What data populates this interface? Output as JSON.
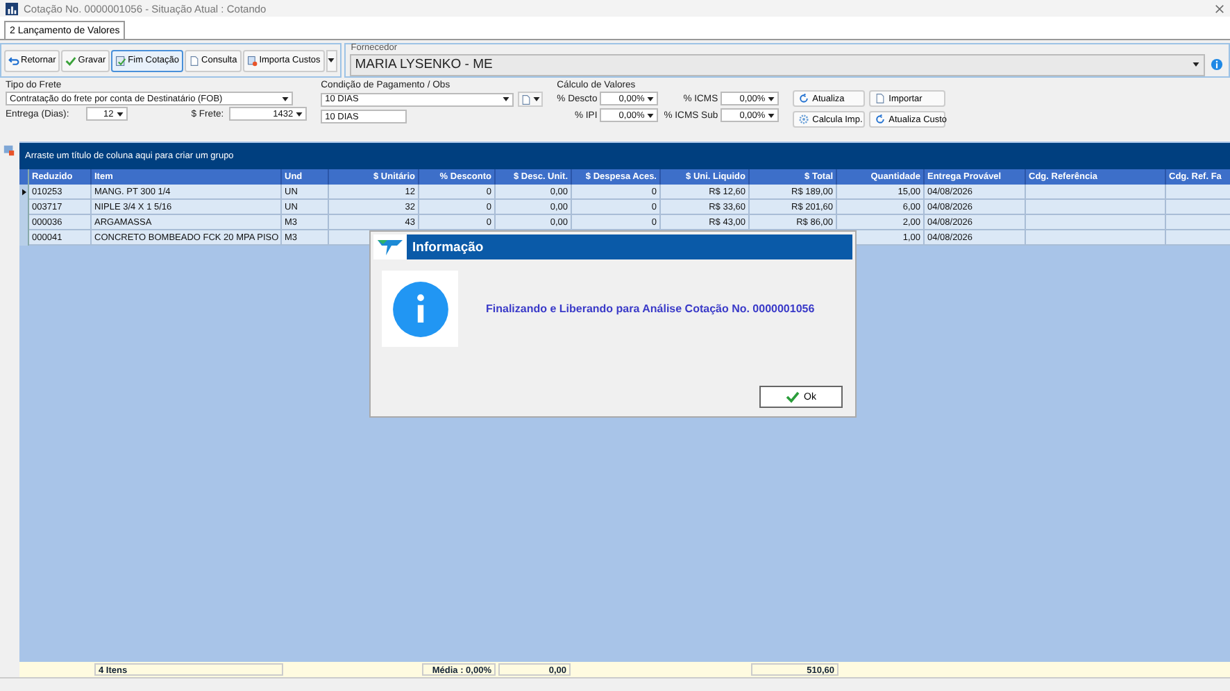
{
  "window": {
    "title": "Cotação No. 0000001056 - Situação Atual : Cotando"
  },
  "tabs": [
    {
      "label": "2 Lançamento de Valores",
      "selected": true
    }
  ],
  "toolbar": [
    {
      "label": "Retornar",
      "kind": "undo",
      "focused": false
    },
    {
      "label": "Gravar",
      "kind": "check",
      "focused": false
    },
    {
      "label": "Fim Cotação",
      "kind": "finish",
      "focused": true
    },
    {
      "label": "Consulta",
      "kind": "doc",
      "focused": false
    },
    {
      "label": "Importa Custos",
      "kind": "import",
      "focused": false
    }
  ],
  "fornecedor": {
    "label": "Fornecedor",
    "value": "MARIA LYSENKO - ME"
  },
  "frete": {
    "label": "Tipo do Frete",
    "value": "Contratação do frete por conta de Destinatário (FOB)",
    "entrega_label": "Entrega (Dias):",
    "entrega": "12",
    "frete_label": "$ Frete:",
    "frete": "1432"
  },
  "pagamento": {
    "label": "Condição de Pagamento / Obs",
    "value": "10 DIAS",
    "obs": "10 DIAS"
  },
  "calculo": {
    "label": "Cálculo de Valores",
    "fields": [
      {
        "label": "% Descto",
        "value": "0,00%"
      },
      {
        "label": "% ICMS",
        "value": "0,00%"
      },
      {
        "label": "% IPI",
        "value": "0,00%"
      },
      {
        "label": "% ICMS Sub",
        "value": "0,00%"
      }
    ],
    "buttons": [
      {
        "label": "Atualiza",
        "kind": "refresh"
      },
      {
        "label": "Importar",
        "kind": "doc"
      },
      {
        "label": "Calcula Imp.",
        "kind": "gear"
      },
      {
        "label": "Atualiza Custo",
        "kind": "refresh"
      }
    ]
  },
  "grid": {
    "group_hint": "Arraste um título de coluna aqui para criar um grupo",
    "columns": [
      {
        "label": "Reduzido",
        "numeric": false
      },
      {
        "label": "Item",
        "numeric": false
      },
      {
        "label": "Und",
        "numeric": false
      },
      {
        "label": "$ Unitário",
        "numeric": true
      },
      {
        "label": "% Desconto",
        "numeric": true
      },
      {
        "label": "$ Desc. Unit.",
        "numeric": true
      },
      {
        "label": "$ Despesa Aces.",
        "numeric": true
      },
      {
        "label": "$ Uni. Liquido",
        "numeric": true
      },
      {
        "label": "$ Total",
        "numeric": true
      },
      {
        "label": "Quantidade",
        "numeric": true
      },
      {
        "label": "Entrega Provável",
        "numeric": false
      },
      {
        "label": "Cdg. Referência",
        "numeric": false
      },
      {
        "label": "Cdg. Ref. Fa",
        "numeric": false
      }
    ],
    "rows": [
      {
        "current": true,
        "cells": [
          "010253",
          " MANG. PT 300 1/4",
          "UN",
          "12",
          "0",
          "0,00",
          "0",
          "R$ 12,60",
          "R$ 189,00",
          "15,00",
          "04/08/2026",
          null,
          null
        ]
      },
      {
        "current": false,
        "cells": [
          "003717",
          "NIPLE 3/4 X 1 5/16",
          "UN",
          "32",
          "0",
          "0,00",
          "0",
          "R$ 33,60",
          "R$ 201,60",
          "6,00",
          "04/08/2026",
          null,
          null
        ]
      },
      {
        "current": false,
        "cells": [
          "000036",
          "ARGAMASSA",
          "M3",
          "43",
          "0",
          "0,00",
          "0",
          "R$ 43,00",
          "R$ 86,00",
          "2,00",
          "04/08/2026",
          null,
          null
        ]
      },
      {
        "current": false,
        "cells": [
          "000041",
          "CONCRETO BOMBEADO FCK 20 MPA PISO",
          "M3",
          null,
          null,
          null,
          null,
          null,
          null,
          "1,00",
          "04/08/2026",
          null,
          null
        ]
      }
    ],
    "footer": {
      "count": "4 Itens",
      "media": "Média : 0,00%",
      "desconto": "0,00",
      "total": "510,60"
    }
  },
  "dialog": {
    "title": "Informação",
    "message": "Finalizando e Liberando para Análise Cotação No. 0000001056",
    "button": "Ok"
  }
}
